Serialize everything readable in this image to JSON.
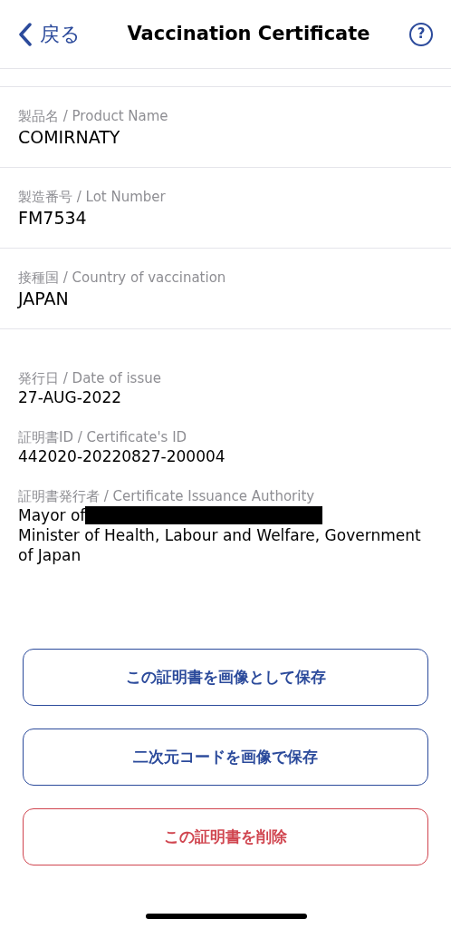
{
  "header": {
    "back_label": "戻る",
    "title": "Vaccination Certificate",
    "help_glyph": "?"
  },
  "vaccine_fields": [
    {
      "label": "製品名 / Product Name",
      "value": "COMIRNATY"
    },
    {
      "label": "製造番号 / Lot Number",
      "value": "FM7534"
    },
    {
      "label": "接種国 / Country of vaccination",
      "value": "JAPAN"
    }
  ],
  "issue_fields": [
    {
      "label": "発行日 / Date of issue",
      "lines": [
        {
          "text": "27-AUG-2022",
          "redacted": false
        }
      ]
    },
    {
      "label": "証明書ID / Certificate's ID",
      "lines": [
        {
          "text": "442020-20220827-200004",
          "redacted": false
        }
      ]
    },
    {
      "label": "証明書発行者 / Certificate Issuance Authority",
      "lines": [
        {
          "text": "Mayor of",
          "redacted": true
        },
        {
          "text": "Minister of Health, Labour and Welfare, Government of Japan",
          "redacted": false
        }
      ]
    }
  ],
  "buttons": [
    {
      "label": "この証明書を画像として保存",
      "kind": "primary"
    },
    {
      "label": "二次元コードを画像で保存",
      "kind": "primary"
    },
    {
      "label": "この証明書を削除",
      "kind": "danger"
    }
  ]
}
